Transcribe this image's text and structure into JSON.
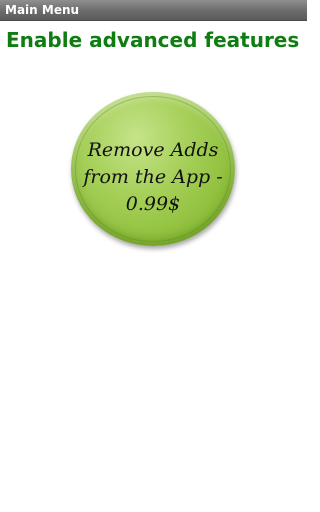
{
  "window": {
    "title": "Main Menu"
  },
  "main": {
    "heading": "Enable advanced features",
    "remove_ads_button": {
      "label": "Remove Adds\nfrom the App -\n0.99$"
    }
  },
  "colors": {
    "heading": "#0f7d12",
    "button_green": "#a8d15c",
    "titlebar": "#6a6a6a"
  }
}
